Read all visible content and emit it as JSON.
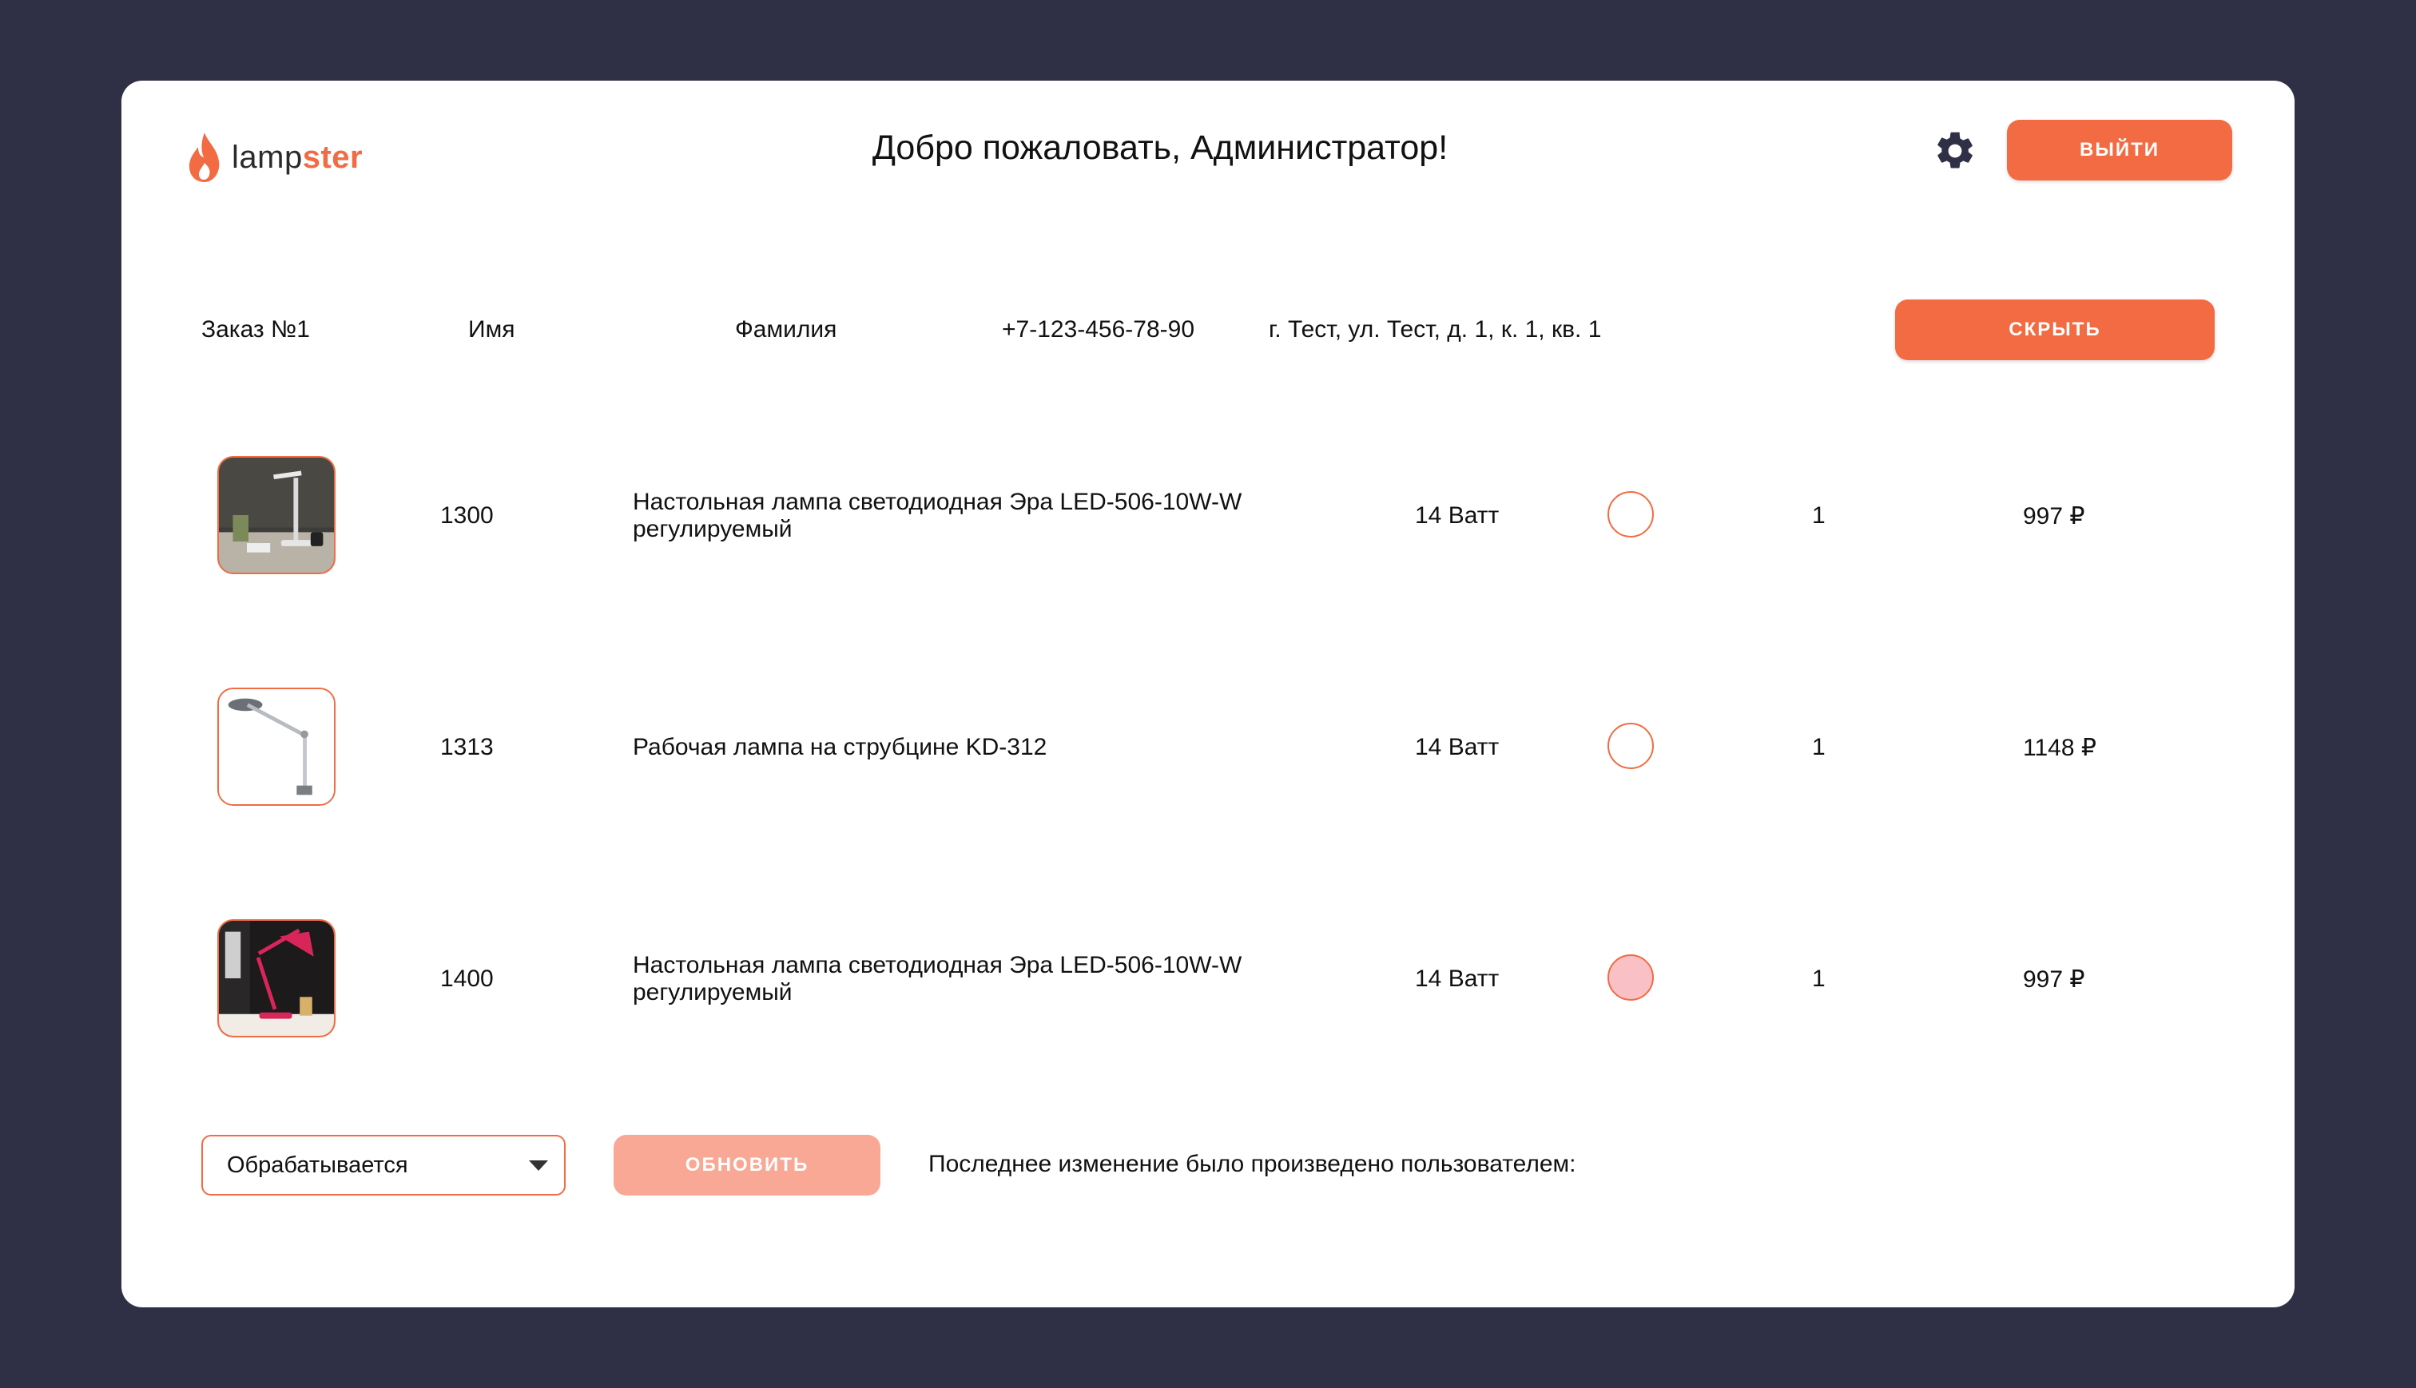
{
  "header": {
    "logo_part1": "lamp",
    "logo_part2": "ster",
    "welcome": "Добро пожаловать, Администратор!",
    "logout_label": "ВЫЙТИ",
    "icons": {
      "settings": "gear-icon",
      "logo": "flame-icon"
    }
  },
  "order": {
    "number": "Заказ №1",
    "first_name": "Имя",
    "last_name": "Фамилия",
    "phone": "+7-123-456-78-90",
    "address": "г. Тест, ул. Тест, д. 1, к. 1, кв. 1",
    "hide_label": "СКРЫТЬ"
  },
  "items": [
    {
      "code": "1300",
      "name": "Настольная лампа светодиодная Эра LED-506-10W-W регулируемый",
      "power": "14 Ватт",
      "color": "#ffffff",
      "qty": "1",
      "price": "997 ₽"
    },
    {
      "code": "1313",
      "name": "Рабочая лампа на струбцине KD-312",
      "power": "14 Ватт",
      "color": "#ffffff",
      "qty": "1",
      "price": "1148 ₽"
    },
    {
      "code": "1400",
      "name": "Настольная лампа светодиодная Эра LED-506-10W-W регулируемый",
      "power": "14 Ватт",
      "color": "#f9c0c6",
      "qty": "1",
      "price": "997 ₽"
    }
  ],
  "footer": {
    "status_selected": "Обрабатывается",
    "update_label": "ОБНОВИТЬ",
    "last_change_text": "Последнее изменение было произведено пользователем:"
  },
  "colors": {
    "accent": "#f26b43",
    "accent_disabled": "#f8a894",
    "background": "#2f3045",
    "card": "#ffffff"
  }
}
